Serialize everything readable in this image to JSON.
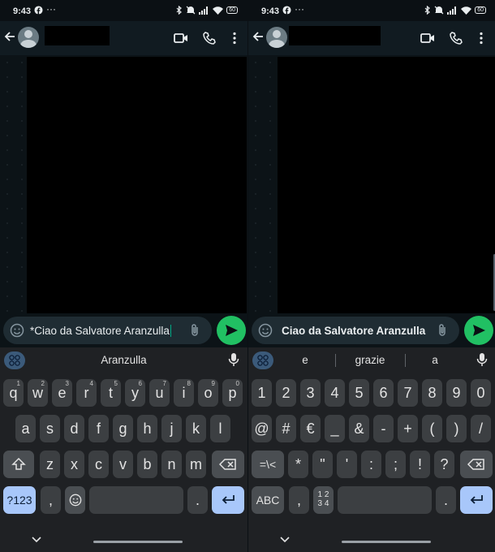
{
  "status": {
    "time": "9:43",
    "dots": "···",
    "battery": "60"
  },
  "chat": {
    "left_message": "*Ciao da Salvatore Aranzulla",
    "right_message": "Ciao da Salvatore Aranzulla"
  },
  "keyboard_left": {
    "suggestions": [
      "Aranzulla"
    ],
    "row1": [
      {
        "k": "q",
        "h": "1"
      },
      {
        "k": "w",
        "h": "2"
      },
      {
        "k": "e",
        "h": "3"
      },
      {
        "k": "r",
        "h": "4"
      },
      {
        "k": "t",
        "h": "5"
      },
      {
        "k": "y",
        "h": "6"
      },
      {
        "k": "u",
        "h": "7"
      },
      {
        "k": "i",
        "h": "8"
      },
      {
        "k": "o",
        "h": "9"
      },
      {
        "k": "p",
        "h": "0"
      }
    ],
    "row2": [
      "a",
      "s",
      "d",
      "f",
      "g",
      "h",
      "j",
      "k",
      "l"
    ],
    "row3": [
      "z",
      "x",
      "c",
      "v",
      "b",
      "n",
      "m"
    ],
    "symbols_label": "?123",
    "comma": ",",
    "period": "."
  },
  "keyboard_right": {
    "suggestions": [
      "e",
      "grazie",
      "a"
    ],
    "row1": [
      "1",
      "2",
      "3",
      "4",
      "5",
      "6",
      "7",
      "8",
      "9",
      "0"
    ],
    "row2": [
      "@",
      "#",
      "€",
      "_",
      "&",
      "-",
      "+",
      "(",
      ")",
      "/"
    ],
    "row3": [
      "*",
      "\"",
      "'",
      ":",
      ";",
      "!",
      "?"
    ],
    "more_symbols_label": "=\\<",
    "abc_label": "ABC",
    "comma": ",",
    "numpad_label": "1 2\n3 4",
    "period": "."
  },
  "colors": {
    "accent": "#21c063",
    "blue_key": "#a8c7fa",
    "header": "#111b21"
  }
}
